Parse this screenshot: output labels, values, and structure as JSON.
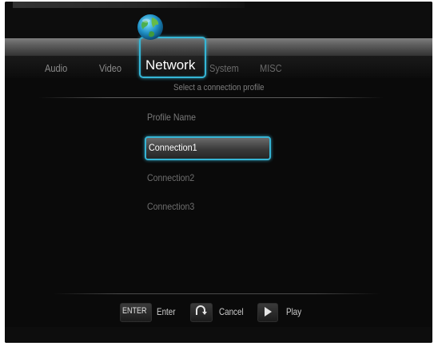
{
  "tabs": {
    "audio": "Audio",
    "video": "Video",
    "network": "Network",
    "system": "System",
    "misc": "MISC"
  },
  "subtitle": "Select a connection profile",
  "profile_header": "Profile Name",
  "profiles": [
    "Connection1",
    "Connection2",
    "Connection3"
  ],
  "selected_profile": "Connection1",
  "hints": {
    "enter_key": "ENTER",
    "enter_label": "Enter",
    "cancel_label": "Cancel",
    "play_label": "Play"
  },
  "icons": {
    "active_tab": "globe-icon",
    "cancel": "back-arrow-icon",
    "play": "play-icon"
  },
  "colors": {
    "highlight": "#35b6d6",
    "background": "#0a0a0a"
  }
}
